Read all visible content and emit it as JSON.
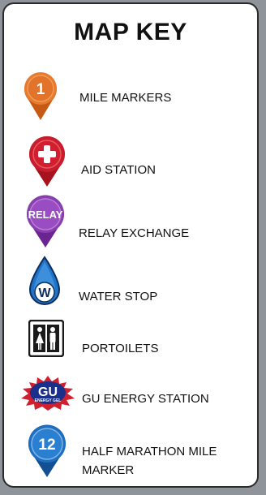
{
  "title": "MAP KEY",
  "items": [
    {
      "label": "MILE MARKERS",
      "icon": "mile-marker-pin-icon",
      "badge": "1",
      "color": "#e2732a"
    },
    {
      "label": "AID STATION",
      "icon": "aid-station-pin-icon",
      "badge": "+",
      "color": "#d0202f"
    },
    {
      "label": "RELAY EXCHANGE",
      "icon": "relay-pin-icon",
      "badge": "RELAY",
      "color": "#8a3fb0"
    },
    {
      "label": "WATER STOP",
      "icon": "water-drop-icon",
      "badge": "W",
      "color": "#1f74c9"
    },
    {
      "label": "PORTOILETS",
      "icon": "restroom-icon",
      "badge": "",
      "color": "#1a1a1a"
    },
    {
      "label": "GU ENERGY STATION",
      "icon": "gu-logo-icon",
      "badge": "GU",
      "badge_sub": "ENERGY GEL",
      "color": "#d0202f"
    },
    {
      "label": "HALF MARATHON MILE MARKER",
      "icon": "half-marathon-pin-icon",
      "badge": "12",
      "color": "#1f6fc0"
    }
  ]
}
